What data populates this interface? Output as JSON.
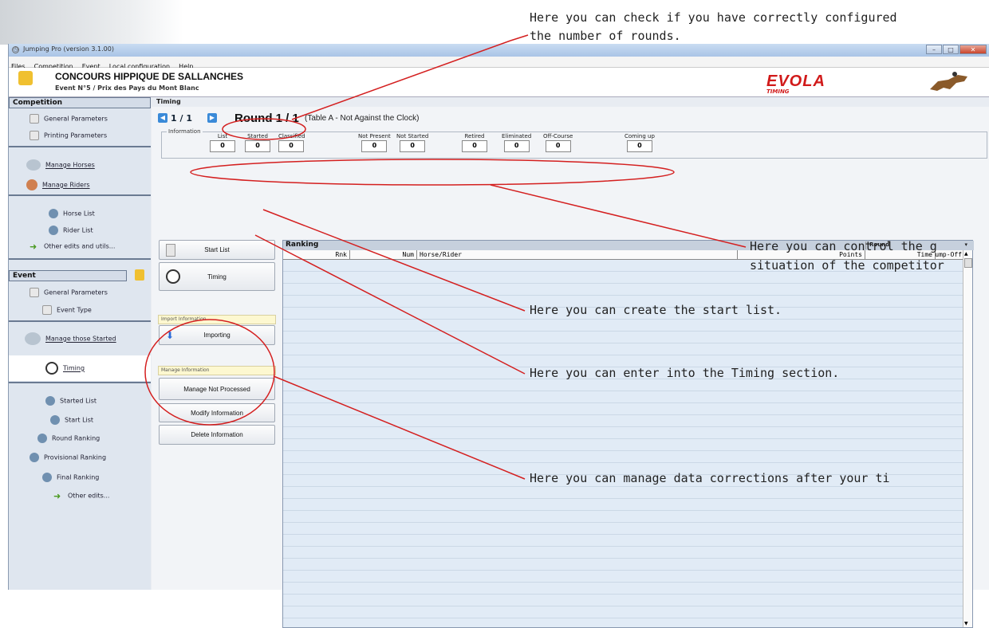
{
  "window": {
    "title": "Jumping Pro (version 3.1.00)"
  },
  "menu": [
    "Files",
    "Competition",
    "Event",
    "Local configuration",
    "Help"
  ],
  "header": {
    "title": "CONCOURS HIPPIQUE DE SALLANCHES",
    "subtitle": "Event N°5 / Prix des Pays du Mont Blanc",
    "logo": "EVOLA",
    "logo_sub": "TIMING"
  },
  "sidebar": {
    "competition_label": "Competition",
    "general_parameters": "General Parameters",
    "printing_parameters": "Printing Parameters",
    "manage_horses": "Manage Horses",
    "manage_riders": "Manage Riders",
    "horse_list": "Horse List",
    "rider_list": "Rider List",
    "other_edits_utils": "Other edits and utils...",
    "event_label": "Event",
    "event_general_parameters": "General Parameters",
    "event_type": "Event Type",
    "manage_started": "Manage those Started",
    "timing": "Timing",
    "started_list": "Started List",
    "start_list": "Start List",
    "round_ranking": "Round Ranking",
    "provisional_ranking": "Provisional Ranking",
    "final_ranking": "Final Ranking",
    "other_edits": "Other edits..."
  },
  "main": {
    "section_title": "Timing",
    "pager": "1 / 1",
    "round_label": "Round 1 / 1",
    "round_sub": "(Table A - Not Against the Clock)",
    "info_label": "Information",
    "stats": [
      {
        "label": "List",
        "value": "0"
      },
      {
        "label": "Started",
        "value": "0"
      },
      {
        "label": "Classified",
        "value": "0"
      },
      {
        "label": "Not Present",
        "value": "0"
      },
      {
        "label": "Not Started",
        "value": "0"
      },
      {
        "label": "Retired",
        "value": "0"
      },
      {
        "label": "Eliminated",
        "value": "0"
      },
      {
        "label": "Off-Course",
        "value": "0"
      },
      {
        "label": "Coming up",
        "value": "0"
      }
    ],
    "start_list_btn": "Start List",
    "timing_btn": "Timing",
    "import_group": "Import Information",
    "importing_btn": "Importing",
    "manage_group": "Manage Information",
    "manage_not_processed_btn": "Manage Not Processed",
    "modify_info_btn": "Modify Information",
    "delete_info_btn": "Delete Information"
  },
  "ranking": {
    "title": "Ranking",
    "selector": "Round",
    "columns": [
      "Rnk",
      "Num",
      "Horse/Rider",
      "Points",
      "Time",
      "Jump-Off"
    ]
  },
  "callouts": {
    "rounds_line1": "Here you can check if you have correctly configured",
    "rounds_line2": "the number of rounds.",
    "situation_line1": "Here you can control the g",
    "situation_line2": "situation of the competitor",
    "start_list": "Here you can create the start list.",
    "timing": "Here you can enter into the Timing section.",
    "manage": "Here you can manage data corrections after your ti"
  },
  "colors": {
    "annotation": "#d41f1f",
    "accent": "#3a8ad8"
  }
}
